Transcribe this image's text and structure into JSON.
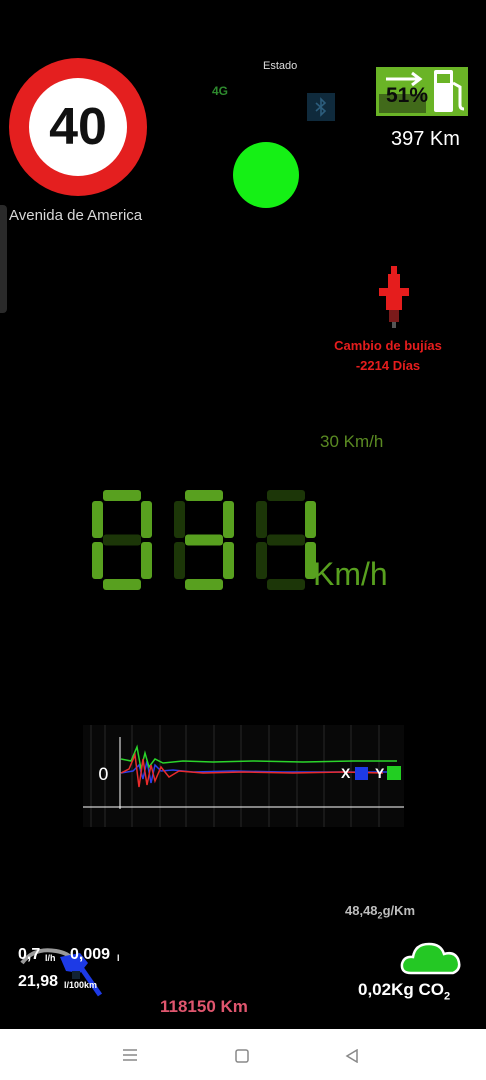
{
  "speed_limit": {
    "value": "40"
  },
  "location": {
    "street": "Avenida de America"
  },
  "status": {
    "title": "Estado",
    "network": "4G",
    "bluetooth_icon": "bluetooth-icon",
    "indicator_color": "#15f015"
  },
  "fuel": {
    "percent_label": "51%",
    "level": 0.51,
    "range": "397 Km",
    "color": "#6ab426"
  },
  "maintenance": {
    "line1": "Cambio de bujías",
    "line2": "-2214 Días",
    "color": "#e51d1d"
  },
  "speed": {
    "gps": "30 Km/h",
    "digits": [
      "0",
      "3",
      "1"
    ],
    "unit": "Km/h",
    "color": "#58a01f"
  },
  "accelerometer": {
    "zero_label": "0",
    "x_label": "X",
    "y_label": "Y",
    "x_color": "#1d3ae6",
    "y_color": "#22ce22"
  },
  "emissions": {
    "rate_value": "48,48",
    "rate_sub": "2",
    "rate_unit": "g/Km",
    "total_value": "0,02Kg CO",
    "total_sub": "2"
  },
  "consumption": {
    "instant_value": "0,7",
    "instant_unit": "l/h",
    "trip_value": "0,009",
    "trip_unit": "l",
    "avg_value": "21,98",
    "avg_unit": "l/100km"
  },
  "odometer": "118150 Km",
  "navigation": {
    "menu_icon": "menu-icon",
    "home_icon": "home-icon",
    "back_icon": "back-icon"
  }
}
